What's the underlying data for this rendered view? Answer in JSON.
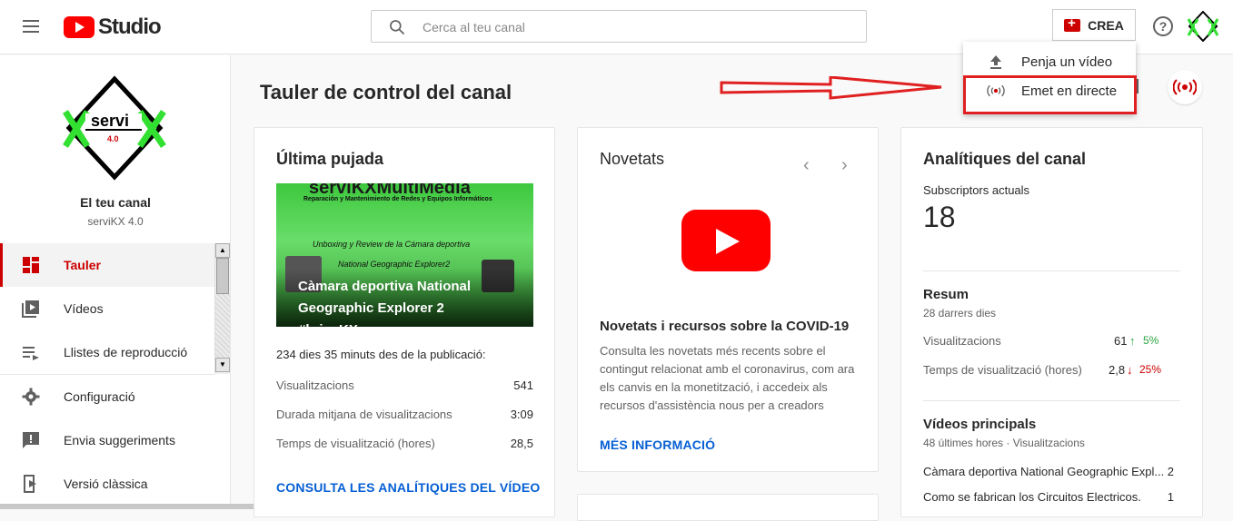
{
  "header": {
    "logo_text": "Studio",
    "search_placeholder": "Cerca al teu canal",
    "create_label": "CREA",
    "help_glyph": "?"
  },
  "sidebar": {
    "channel_title": "El teu canal",
    "channel_name": "serviKX 4.0",
    "items": [
      {
        "label": "Tauler",
        "icon": "dashboard-icon",
        "active": true
      },
      {
        "label": "Vídeos",
        "icon": "videos-icon"
      },
      {
        "label": "Llistes de reproducció",
        "icon": "playlists-icon"
      },
      {
        "label": "Configuració",
        "icon": "gear-icon"
      },
      {
        "label": "Envia suggeriments",
        "icon": "feedback-icon"
      },
      {
        "label": "Versió clàssica",
        "icon": "classic-icon"
      }
    ]
  },
  "page": {
    "title": "Tauler de control del canal"
  },
  "dropdown": {
    "items": [
      {
        "label": "Penja un vídeo",
        "icon": "upload-icon"
      },
      {
        "label": "Emet en directe",
        "icon": "live-icon"
      }
    ]
  },
  "latest_upload": {
    "heading": "Última pujada",
    "thumb_brand": "serviKXMultiMedia",
    "thumb_sub": "Reparación y Mantenimiento de Redes y Equipos Informáticos",
    "thumb_line1": "Unboxing y Review de la Cámara deportiva",
    "thumb_line2": "National Geographic Explorer2",
    "video_title": "Càmara deportiva National Geographic Explorer 2 #bricoKX...",
    "since": "234 dies 35 minuts des de la publicació:",
    "stats": [
      {
        "label": "Visualitzacions",
        "value": "541"
      },
      {
        "label": "Durada mitjana de visualitzacions",
        "value": "3:09"
      },
      {
        "label": "Temps de visualització (hores)",
        "value": "28,5"
      }
    ],
    "link": "CONSULTA LES ANALÍTIQUES DEL VÍDEO"
  },
  "news": {
    "heading": "Novetats",
    "prev": "‹",
    "next": "›",
    "article_title": "Novetats i recursos sobre la COVID-19",
    "article_body": "Consulta les novetats més recents sobre el contingut relacionat amb el coronavirus, com ara els canvis en la monetització, i accedeix als recursos d'assistència nous per a creadors",
    "link": "MÉS INFORMACIÓ"
  },
  "analytics": {
    "heading": "Analítiques del canal",
    "subs_label": "Subscriptors actuals",
    "subs_value": "18",
    "summary_heading": "Resum",
    "summary_period": "28 darrers dies",
    "summary": [
      {
        "label": "Visualitzacions",
        "value": "61",
        "delta": "5%",
        "direction": "up",
        "color": "#2ba640"
      },
      {
        "label": "Temps de visualització (hores)",
        "value": "2,8",
        "delta": "25%",
        "direction": "down",
        "color": "#cc0000"
      }
    ],
    "top_heading": "Vídeos principals",
    "top_period": "48 últimes hores · Visualitzacions",
    "top_videos": [
      {
        "title": "Càmara deportiva National Geographic Expl...",
        "views": "2"
      },
      {
        "title": "Como se fabrican los Circuitos Electricos.",
        "views": "1"
      }
    ]
  }
}
